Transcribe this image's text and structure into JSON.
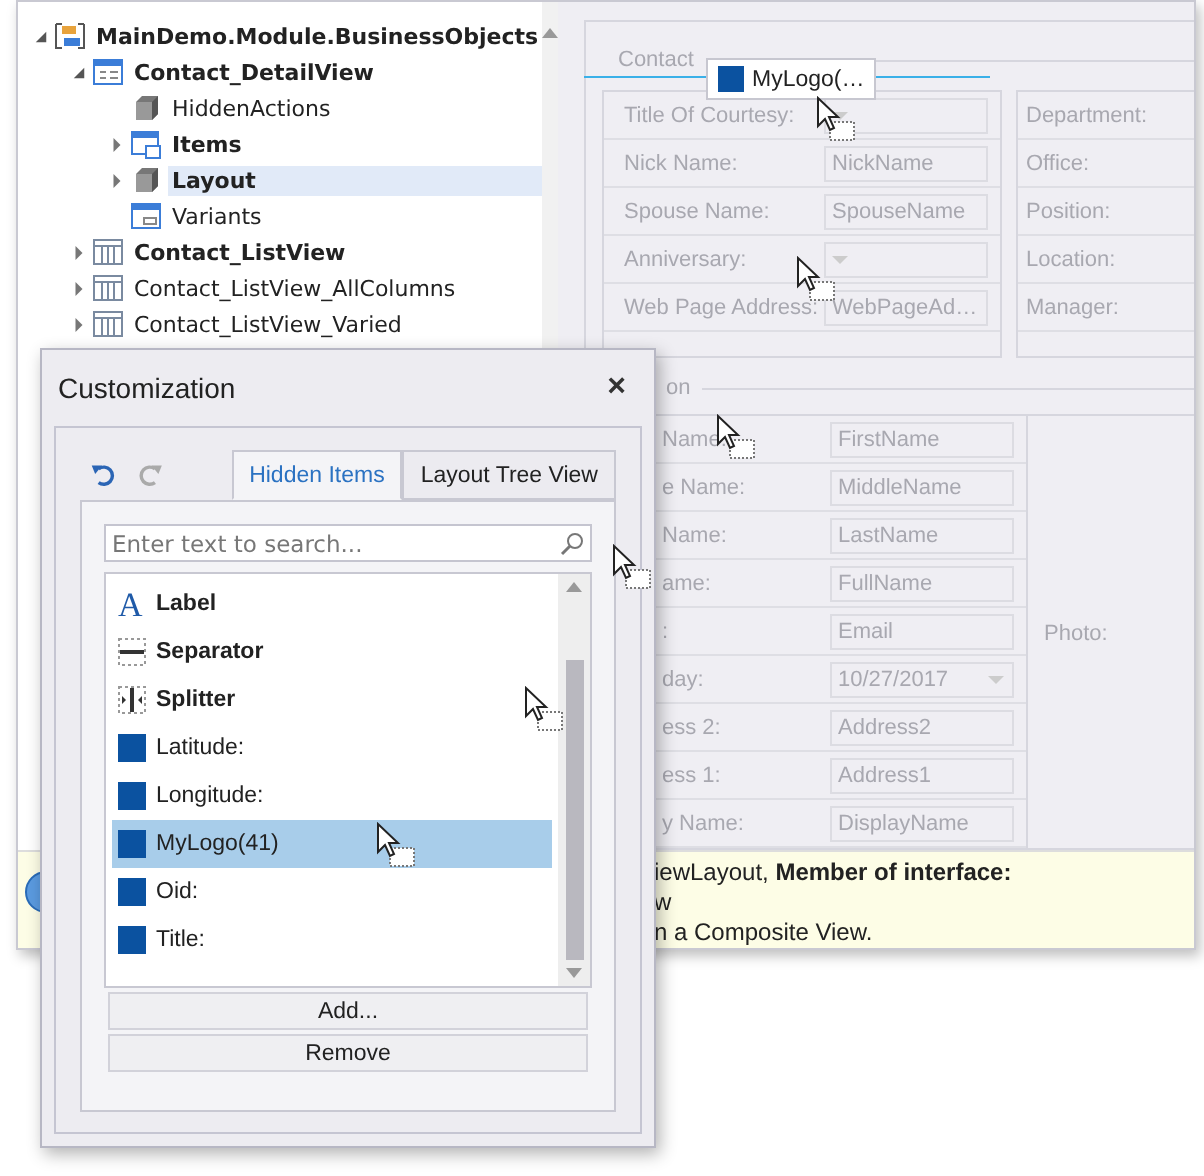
{
  "tree": [
    {
      "label": "MainDemo.Module.BusinessObjects",
      "kind": "module",
      "bold": true,
      "expanded": true,
      "selected": false,
      "children": [
        {
          "label": "Contact_DetailView",
          "kind": "detail",
          "bold": true,
          "expanded": true,
          "selected": false,
          "children": [
            {
              "label": "HiddenActions",
              "kind": "cube",
              "bold": false,
              "selected": false
            },
            {
              "label": "Items",
              "kind": "items",
              "bold": true,
              "expanded": false,
              "selected": false
            },
            {
              "label": "Layout",
              "kind": "cube",
              "bold": true,
              "expanded": false,
              "selected": true
            },
            {
              "label": "Variants",
              "kind": "variants",
              "bold": false,
              "selected": false
            }
          ]
        },
        {
          "label": "Contact_ListView",
          "kind": "list",
          "bold": true,
          "expanded": false,
          "selected": false
        },
        {
          "label": "Contact_ListView_AllColumns",
          "kind": "list",
          "bold": false,
          "expanded": false,
          "selected": false
        },
        {
          "label": "Contact_ListView_Varied",
          "kind": "list",
          "bold": false,
          "expanded": false,
          "selected": false
        }
      ]
    }
  ],
  "layout": {
    "group_caption": "Contact",
    "drag_item": "MyLogo(…",
    "left_rows": [
      {
        "label": "Title Of Courtesy:",
        "kind": "combo"
      },
      {
        "label": "Nick Name:",
        "kind": "text",
        "value": "NickName"
      },
      {
        "label": "Spouse Name:",
        "kind": "text",
        "value": "SpouseName"
      },
      {
        "label": "Anniversary:",
        "kind": "combo"
      },
      {
        "label": "Web Page Address:",
        "kind": "text",
        "value": "WebPageAd…"
      }
    ],
    "right_rows": [
      "Department:",
      "Office:",
      "Position:",
      "Location:",
      "Manager:"
    ],
    "group2_caption": "on",
    "rows2": [
      {
        "label": "Name:",
        "kind": "text",
        "value": "FirstName"
      },
      {
        "label": "e Name:",
        "kind": "text",
        "value": "MiddleName"
      },
      {
        "label": "Name:",
        "kind": "text",
        "value": "LastName"
      },
      {
        "label": "ame:",
        "kind": "text",
        "value": "FullName"
      },
      {
        "label": ":",
        "kind": "text",
        "value": "Email"
      },
      {
        "label": "day:",
        "kind": "combo",
        "value": "10/27/2017"
      },
      {
        "label": "ess 2:",
        "kind": "text",
        "value": "Address2"
      },
      {
        "label": "ess 1:",
        "kind": "text",
        "value": "Address1"
      },
      {
        "label": "y Name:",
        "kind": "text",
        "value": "DisplayName"
      }
    ],
    "photo_label": "Photo:"
  },
  "info": [
    "iewLayout, **Member of interface:**",
    "w",
    "n a Composite View."
  ],
  "dialog": {
    "title": "Customization",
    "close": "×",
    "tabs": [
      {
        "label": "Hidden Items",
        "selected": true
      },
      {
        "label": "Layout Tree View",
        "selected": false
      }
    ],
    "search": {
      "placeholder": "Enter text to search..."
    },
    "items": [
      {
        "label": "Label",
        "kind": "label",
        "glyph": "A",
        "selected": false
      },
      {
        "label": "Separator",
        "kind": "separator",
        "selected": false
      },
      {
        "label": "Splitter",
        "kind": "splitter",
        "selected": false
      },
      {
        "label": "Latitude:",
        "kind": "field",
        "selected": false
      },
      {
        "label": "Longitude:",
        "kind": "field",
        "selected": false
      },
      {
        "label": "MyLogo(41)",
        "kind": "field",
        "selected": true
      },
      {
        "label": "Oid:",
        "kind": "field",
        "selected": false
      },
      {
        "label": "Title:",
        "kind": "field",
        "selected": false
      }
    ],
    "buttons": [
      "Add...",
      "Remove"
    ]
  }
}
